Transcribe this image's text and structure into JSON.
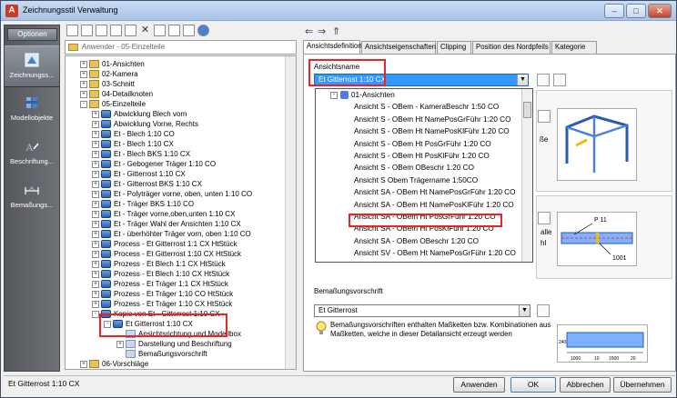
{
  "window": {
    "title": "Zeichnungsstil Verwaltung",
    "app_glyph": "A"
  },
  "window_controls": {
    "minimize": "–",
    "maximize": "□",
    "close": "✕"
  },
  "sidebar": {
    "header": "Optionen",
    "items": [
      {
        "label": "Zeichnungss...",
        "icon": "drawing-style-icon",
        "selected": true
      },
      {
        "label": "Modellobjekte",
        "icon": "model-objects-icon",
        "selected": false
      },
      {
        "label": "Beschriftung...",
        "icon": "annotation-icon",
        "selected": false
      },
      {
        "label": "Bemaßungs...",
        "icon": "dimension-icon",
        "selected": false
      }
    ]
  },
  "left": {
    "path": "Anwender - 05-Einzelteile",
    "tree": [
      {
        "label": "01-Ansichten",
        "lvl": 1,
        "ex": "+",
        "icon": "folder"
      },
      {
        "label": "02-Kamera",
        "lvl": 1,
        "ex": "+",
        "icon": "folder"
      },
      {
        "label": "03-Schnitt",
        "lvl": 1,
        "ex": "+",
        "icon": "folder"
      },
      {
        "label": "04-Detailknoten",
        "lvl": 1,
        "ex": "+",
        "icon": "folder"
      },
      {
        "label": "05-Einzelteile",
        "lvl": 1,
        "ex": "-",
        "icon": "folder"
      },
      {
        "label": "Abwicklung Blech vorn",
        "lvl": 2,
        "ex": "+",
        "icon": "style"
      },
      {
        "label": "Abwicklung Vorne, Rechts",
        "lvl": 2,
        "ex": "+",
        "icon": "style"
      },
      {
        "label": "Et - Blech 1:10 CO",
        "lvl": 2,
        "ex": "+",
        "icon": "style"
      },
      {
        "label": "Et - Blech 1:10 CX",
        "lvl": 2,
        "ex": "+",
        "icon": "style"
      },
      {
        "label": "Et - Blech BKS 1:10 CX",
        "lvl": 2,
        "ex": "+",
        "icon": "style"
      },
      {
        "label": "Et - Gebogener Träger 1:10 CO",
        "lvl": 2,
        "ex": "+",
        "icon": "style"
      },
      {
        "label": "Et - Gitterrost 1:10 CX",
        "lvl": 2,
        "ex": "+",
        "icon": "style"
      },
      {
        "label": "Et - Gitterrost BKS 1:10 CX",
        "lvl": 2,
        "ex": "+",
        "icon": "style"
      },
      {
        "label": "Et - Polyträger vorne, oben, unten 1:10 CO",
        "lvl": 2,
        "ex": "+",
        "icon": "style"
      },
      {
        "label": "Et - Träger BKS 1:10 CO",
        "lvl": 2,
        "ex": "+",
        "icon": "style"
      },
      {
        "label": "Et - Träger vorne,oben,unten 1:10 CX",
        "lvl": 2,
        "ex": "+",
        "icon": "style"
      },
      {
        "label": "Et - Träger Wahl der Ansichten 1:10 CX",
        "lvl": 2,
        "ex": "+",
        "icon": "style"
      },
      {
        "label": "Et - überhöhter Träger vorn, oben 1:10 CO",
        "lvl": 2,
        "ex": "+",
        "icon": "style"
      },
      {
        "label": "Process - Et Gitterrost 1:1 CX HtStück",
        "lvl": 2,
        "ex": "+",
        "icon": "style"
      },
      {
        "label": "Process - Et Gitterrost 1:10 CX HtStück",
        "lvl": 2,
        "ex": "+",
        "icon": "style"
      },
      {
        "label": "Prozess - Et Blech 1:1 CX HtStück",
        "lvl": 2,
        "ex": "+",
        "icon": "style"
      },
      {
        "label": "Prozess - Et Blech 1:10 CX HtStück",
        "lvl": 2,
        "ex": "+",
        "icon": "style"
      },
      {
        "label": "Prozess - Et Träger 1:1 CX HtStück",
        "lvl": 2,
        "ex": "+",
        "icon": "style"
      },
      {
        "label": "Prozess - Et Träger 1:10 CO HtStück",
        "lvl": 2,
        "ex": "+",
        "icon": "style"
      },
      {
        "label": "Prozess - Et Träger 1:10 CX HtStück",
        "lvl": 2,
        "ex": "+",
        "icon": "style"
      },
      {
        "label": "Kopie von Et - Gitterrost 1:10 CX",
        "lvl": 2,
        "ex": "-",
        "icon": "style"
      },
      {
        "label": "Et Gitterrost 1:10 CX",
        "lvl": 3,
        "ex": "-",
        "icon": "style"
      },
      {
        "label": "Ansichtsrichtung und Modellbox",
        "lvl": 4,
        "ex": "",
        "icon": "sub"
      },
      {
        "label": "Darstellung und Beschriftung",
        "lvl": 4,
        "ex": "+",
        "icon": "sub"
      },
      {
        "label": "Bemaßungsvorschrift",
        "lvl": 4,
        "ex": "",
        "icon": "sub"
      },
      {
        "label": "06-Vorschläge",
        "lvl": 1,
        "ex": "+",
        "icon": "folder"
      }
    ]
  },
  "nav": {
    "back": "⇐",
    "forward": "⇒",
    "up": "⇑"
  },
  "tabs": [
    "Ansichtsdefinition",
    "Ansichtseigenschaften",
    "Clipping",
    "Position des Nordpfeils",
    "Kategorie"
  ],
  "right": {
    "ansichtsname_label": "Ansichtsname",
    "selected_view": "Et Gitterrost 1:10 CX",
    "dropdown_items": [
      {
        "label": "01-Ansichten",
        "lvl": 1
      },
      {
        "label": "Ansicht S - OBem - KameraBeschr 1:50 CO",
        "lvl": 2
      },
      {
        "label": "Ansicht S - OBem Ht NamePosGrFühr 1:20 CO",
        "lvl": 2
      },
      {
        "label": "Ansicht S - OBem Ht NamePosKlFühr 1:20 CO",
        "lvl": 2
      },
      {
        "label": "Ansicht S - OBem Ht PosGrFühr 1:20 CO",
        "lvl": 2
      },
      {
        "label": "Ansicht S - OBem Ht PosKlFühr 1:20 CO",
        "lvl": 2
      },
      {
        "label": "Ansicht S - OBem OBeschr 1:20 CO",
        "lvl": 2
      },
      {
        "label": "Ansicht S Obem Trägername 1:50CO",
        "lvl": 2
      },
      {
        "label": "Ansicht SA - OBem Ht NamePosGrFühr 1:20 CO",
        "lvl": 2
      },
      {
        "label": "Ansicht SA - OBem Ht NamePosKlFühr 1:20 CO",
        "lvl": 2
      },
      {
        "label": "Ansicht SA - OBem Ht PosGrFühr 1:20 CO",
        "lvl": 2
      },
      {
        "label": "Ansicht SA - OBem Ht PosKlFühr 1:20 CO",
        "lvl": 2
      },
      {
        "label": "Ansicht SA - OBem OBeschr 1:20 CO",
        "lvl": 2
      },
      {
        "label": "Ansicht SV - OBem Ht NamePosGrFühr 1:20 CO",
        "lvl": 2
      }
    ],
    "side_text_1": "ße",
    "side_text_2": "alle",
    "side_text_3": "hl",
    "bemassung_label": "Bemaßungsvorschrift",
    "bemassung_value": "Et Gitterrost",
    "note": "Bemaßungsvorschriften enthalten Maßketten bzw. Kombinationen aus Maßketten, welche in dieser Detailansicht erzeugt werden",
    "preview2": {
      "label_top": "P 11",
      "label_bottom": "1001"
    },
    "preview3": {
      "dims": [
        "240",
        "1000",
        "10",
        "1500",
        "20"
      ]
    }
  },
  "status": "Et Gitterrost 1:10 CX",
  "buttons": {
    "apply": "Anwenden",
    "ok": "OK",
    "cancel": "Abbrechen",
    "accept": "Übernehmen"
  }
}
